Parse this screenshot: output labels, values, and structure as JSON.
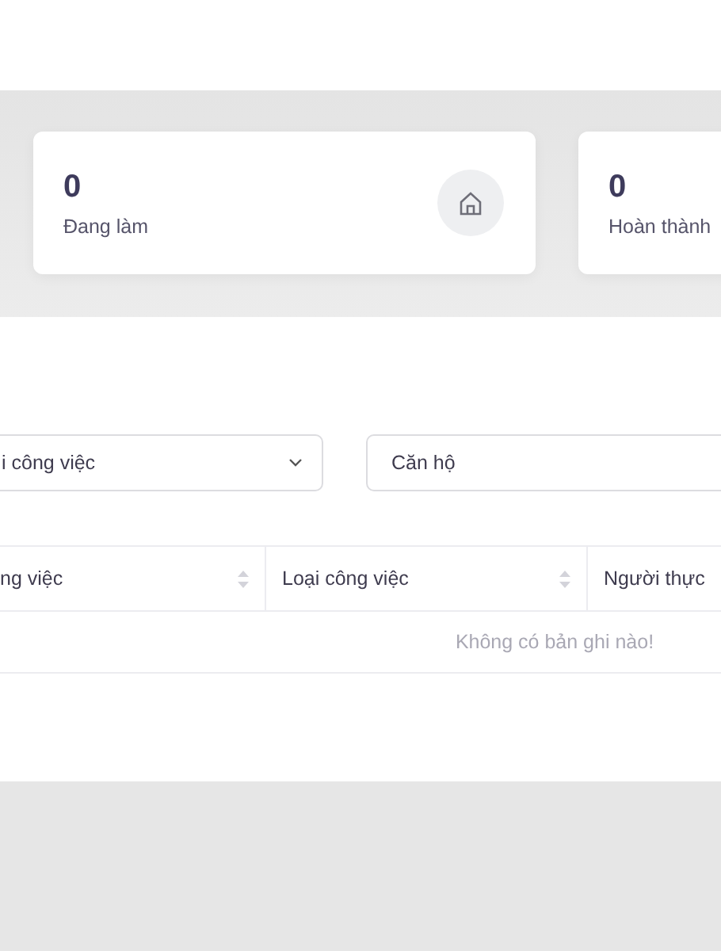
{
  "stats": [
    {
      "value": "0",
      "label": "Đang làm"
    },
    {
      "value": "0",
      "label": "Hoàn thành"
    }
  ],
  "filters": [
    {
      "value": "i công việc"
    },
    {
      "value": "Căn hộ"
    }
  ],
  "table": {
    "columns": [
      {
        "label": "ng việc",
        "sortable": true
      },
      {
        "label": "Loại công việc",
        "sortable": true
      },
      {
        "label": "Người thực",
        "sortable": false
      }
    ],
    "empty_text": "Không có bản ghi nào!"
  }
}
